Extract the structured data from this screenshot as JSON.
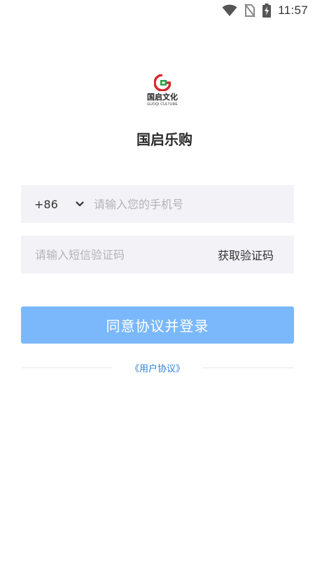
{
  "status_bar": {
    "time": "11:57",
    "icons": [
      "wifi-icon",
      "no-sim-icon",
      "battery-charging-icon"
    ]
  },
  "logo": {
    "brand_name": "国启文化",
    "brand_sub": "GUOQI CULTURE",
    "mark_letter": "G",
    "colors": {
      "red": "#d9252b",
      "green": "#2e9e47"
    }
  },
  "app_title": "国启乐购",
  "phone_field": {
    "country_code": "+86",
    "placeholder": "请输入您的手机号",
    "value": ""
  },
  "code_field": {
    "placeholder": "请输入短信验证码",
    "value": "",
    "get_code_label": "获取验证码"
  },
  "login_button": {
    "label": "同意协议并登录"
  },
  "agreement": {
    "link_label": "《用户协议》"
  },
  "colors": {
    "primary_button": "#7ab8fb",
    "link": "#2f7fd9",
    "field_background": "#f3f3f7"
  }
}
